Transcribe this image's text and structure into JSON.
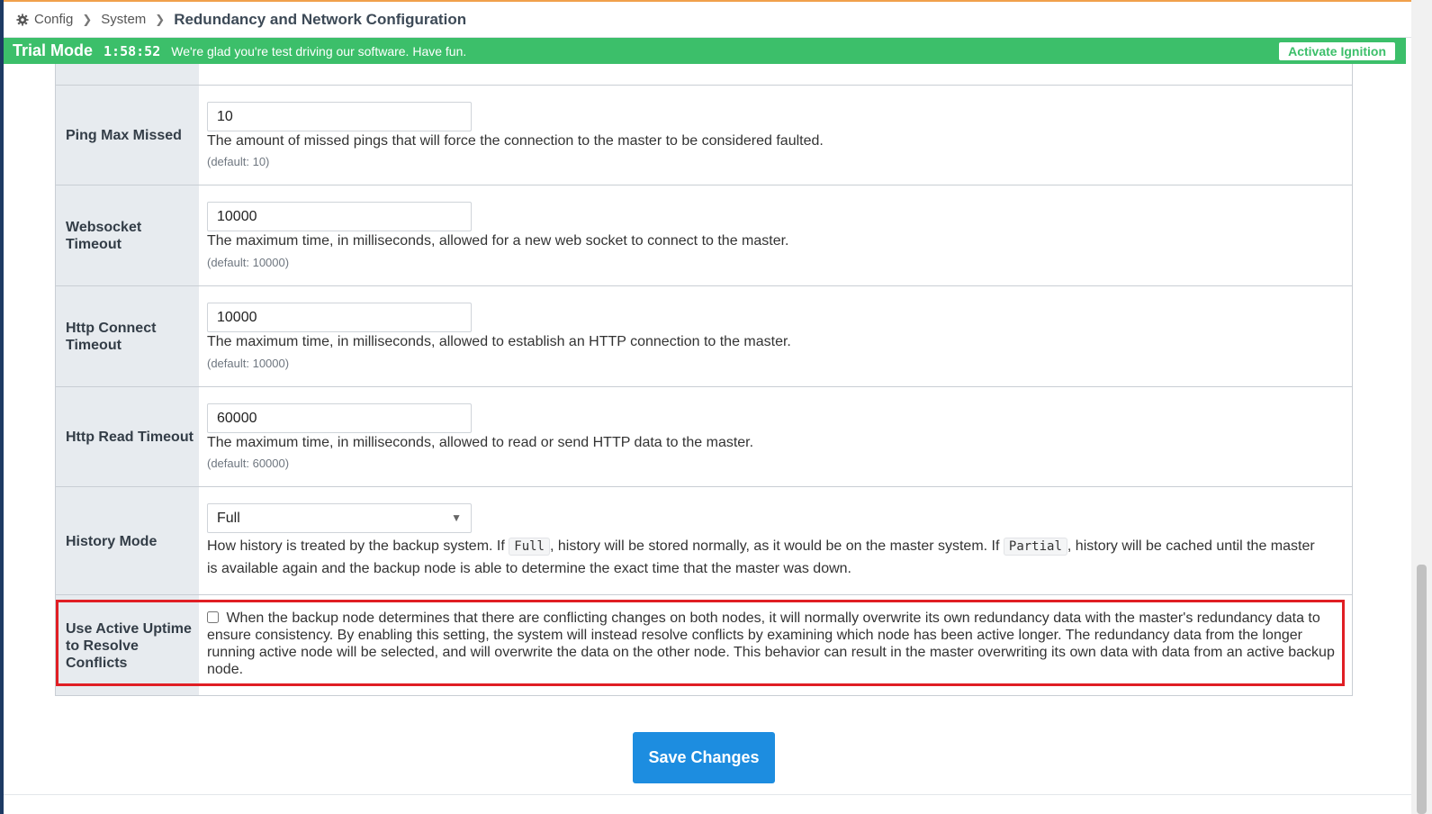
{
  "breadcrumb": {
    "items": [
      "Config",
      "System"
    ],
    "current": "Redundancy and Network Configuration",
    "icon": "gear-icon"
  },
  "trial": {
    "mode": "Trial Mode",
    "timer": "1:58:52",
    "message": "We're glad you're test driving our software. Have fun.",
    "activate_label": "Activate Ignition",
    "color": "#3cbf6a"
  },
  "fields": {
    "ping_max_missed": {
      "label": "Ping Max Missed",
      "value": "10",
      "description": "The amount of missed pings that will force the connection to the master to be considered faulted.",
      "default": "(default: 10)"
    },
    "websocket_timeout": {
      "label": "Websocket Timeout",
      "value": "10000",
      "description": "The maximum time, in milliseconds, allowed for a new web socket to connect to the master.",
      "default": "(default: 10000)"
    },
    "http_connect_timeout": {
      "label": "Http Connect Timeout",
      "value": "10000",
      "description": "The maximum time, in milliseconds, allowed to establish an HTTP connection to the master.",
      "default": "(default: 10000)"
    },
    "http_read_timeout": {
      "label": "Http Read Timeout",
      "value": "60000",
      "description": "The maximum time, in milliseconds, allowed to read or send HTTP data to the master.",
      "default": "(default: 60000)"
    },
    "history_mode": {
      "label": "History Mode",
      "value": "Full",
      "desc_part1": "How history is treated by the backup system. If",
      "code_full": "Full",
      "desc_part2": ", history will be stored normally, as it would be on the master system. If",
      "code_partial": "Partial",
      "desc_part3": ", history will be cached until the master",
      "desc_line2": "is available again and the backup node is able to determine the exact time that the master was down."
    },
    "use_active_uptime": {
      "label": "Use Active Uptime to Resolve Conflicts",
      "checked": false,
      "description": "When the backup node determines that there are conflicting changes on both nodes, it will normally overwrite its own redundancy data with the master's redundancy data to ensure consistency. By enabling this setting, the system will instead resolve conflicts by examining which node has been active longer. The redundancy data from the longer running active node will be selected, and will overwrite the data on the other node. This behavior can result in the master overwriting its own data with data from an active backup node."
    }
  },
  "save_label": "Save Changes",
  "colors": {
    "save_button": "#1d8de0",
    "highlight": "#e01e24",
    "label_bg": "#e7ebef"
  }
}
